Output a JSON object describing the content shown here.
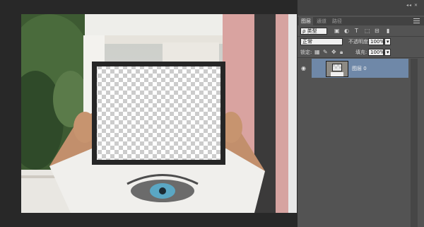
{
  "panel": {
    "collapse_glyph": "◂◂  ✕",
    "tabs": [
      "图层",
      "通道",
      "路径"
    ],
    "filter": {
      "kind_label": "ρ 类型",
      "icons": [
        "image-filter-icon",
        "adjustment-filter-icon",
        "type-filter-icon",
        "shape-filter-icon",
        "smart-object-filter-icon"
      ]
    },
    "blend_mode": "正常",
    "opacity_label": "不透明度:",
    "opacity_value": "100%",
    "lock_label": "锁定:",
    "fill_label": "填充:",
    "fill_value": "100%",
    "layers": [
      {
        "name": "图层 0",
        "visible": true
      }
    ]
  }
}
